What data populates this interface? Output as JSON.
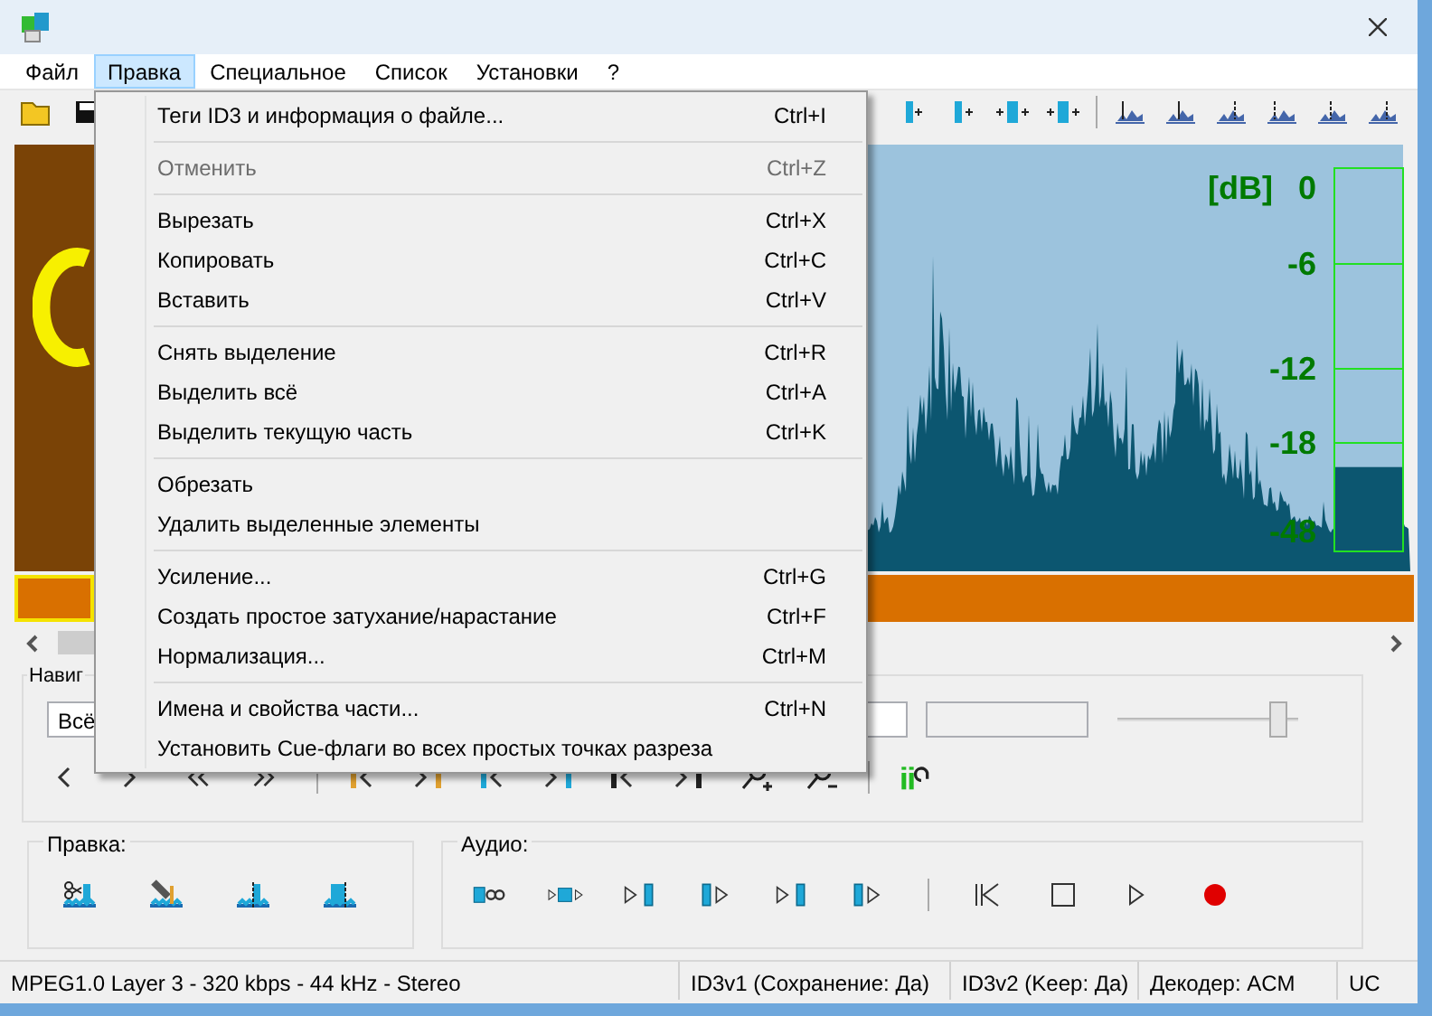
{
  "menu_bar": [
    {
      "label": "Файл",
      "selected": false
    },
    {
      "label": "Правка",
      "selected": true
    },
    {
      "label": "Специальное",
      "selected": false
    },
    {
      "label": "Список",
      "selected": false
    },
    {
      "label": "Установки",
      "selected": false
    },
    {
      "label": "?",
      "selected": false
    }
  ],
  "edit_menu": [
    {
      "kind": "item",
      "label": "Теги ID3 и информация о файле...",
      "shortcut": "Ctrl+I",
      "disabled": false
    },
    {
      "kind": "separator"
    },
    {
      "kind": "item",
      "label": "Отменить",
      "shortcut": "Ctrl+Z",
      "disabled": true
    },
    {
      "kind": "separator"
    },
    {
      "kind": "item",
      "label": "Вырезать",
      "shortcut": "Ctrl+X",
      "disabled": false
    },
    {
      "kind": "item",
      "label": "Копировать",
      "shortcut": "Ctrl+C",
      "disabled": false
    },
    {
      "kind": "item",
      "label": "Вставить",
      "shortcut": "Ctrl+V",
      "disabled": false
    },
    {
      "kind": "separator"
    },
    {
      "kind": "item",
      "label": "Снять выделение",
      "shortcut": "Ctrl+R",
      "disabled": false
    },
    {
      "kind": "item",
      "label": "Выделить всё",
      "shortcut": "Ctrl+A",
      "disabled": false
    },
    {
      "kind": "item",
      "label": "Выделить текущую часть",
      "shortcut": "Ctrl+K",
      "disabled": false
    },
    {
      "kind": "separator"
    },
    {
      "kind": "item",
      "label": "Обрезать",
      "disabled": false
    },
    {
      "kind": "item",
      "label": "Удалить выделенные элементы",
      "disabled": false
    },
    {
      "kind": "separator"
    },
    {
      "kind": "item",
      "label": "Усиление...",
      "shortcut": "Ctrl+G",
      "disabled": false
    },
    {
      "kind": "item",
      "label": "Создать простое затухание/нарастание",
      "shortcut": "Ctrl+F",
      "disabled": false
    },
    {
      "kind": "item",
      "label": "Нормализация...",
      "shortcut": "Ctrl+M",
      "disabled": false
    },
    {
      "kind": "separator"
    },
    {
      "kind": "item",
      "label": "Имена и свойства части...",
      "shortcut": "Ctrl+N",
      "disabled": false
    },
    {
      "kind": "item",
      "label": "Установить Cue-флаги во всех простых точках разреза",
      "disabled": false
    }
  ],
  "level_meter": {
    "unit": "[dB]",
    "scale": [
      "0",
      "-6",
      "-12",
      "-18",
      "-48"
    ],
    "level": 0.22
  },
  "navigation": {
    "label": "Навиг",
    "mode_field": "Всё",
    "slider": {
      "level": 0.93
    }
  },
  "edit_panel": {
    "label": "Правка:"
  },
  "audio_panel": {
    "label": "Аудио:"
  },
  "status_bar": [
    "MPEG1.0 Layer 3 - 320 kbps - 44 kHz - Stereo",
    "ID3v1 (Сохранение: Да)",
    "ID3v2 (Keep: Да)",
    "Декодер: ACM",
    "UC"
  ]
}
